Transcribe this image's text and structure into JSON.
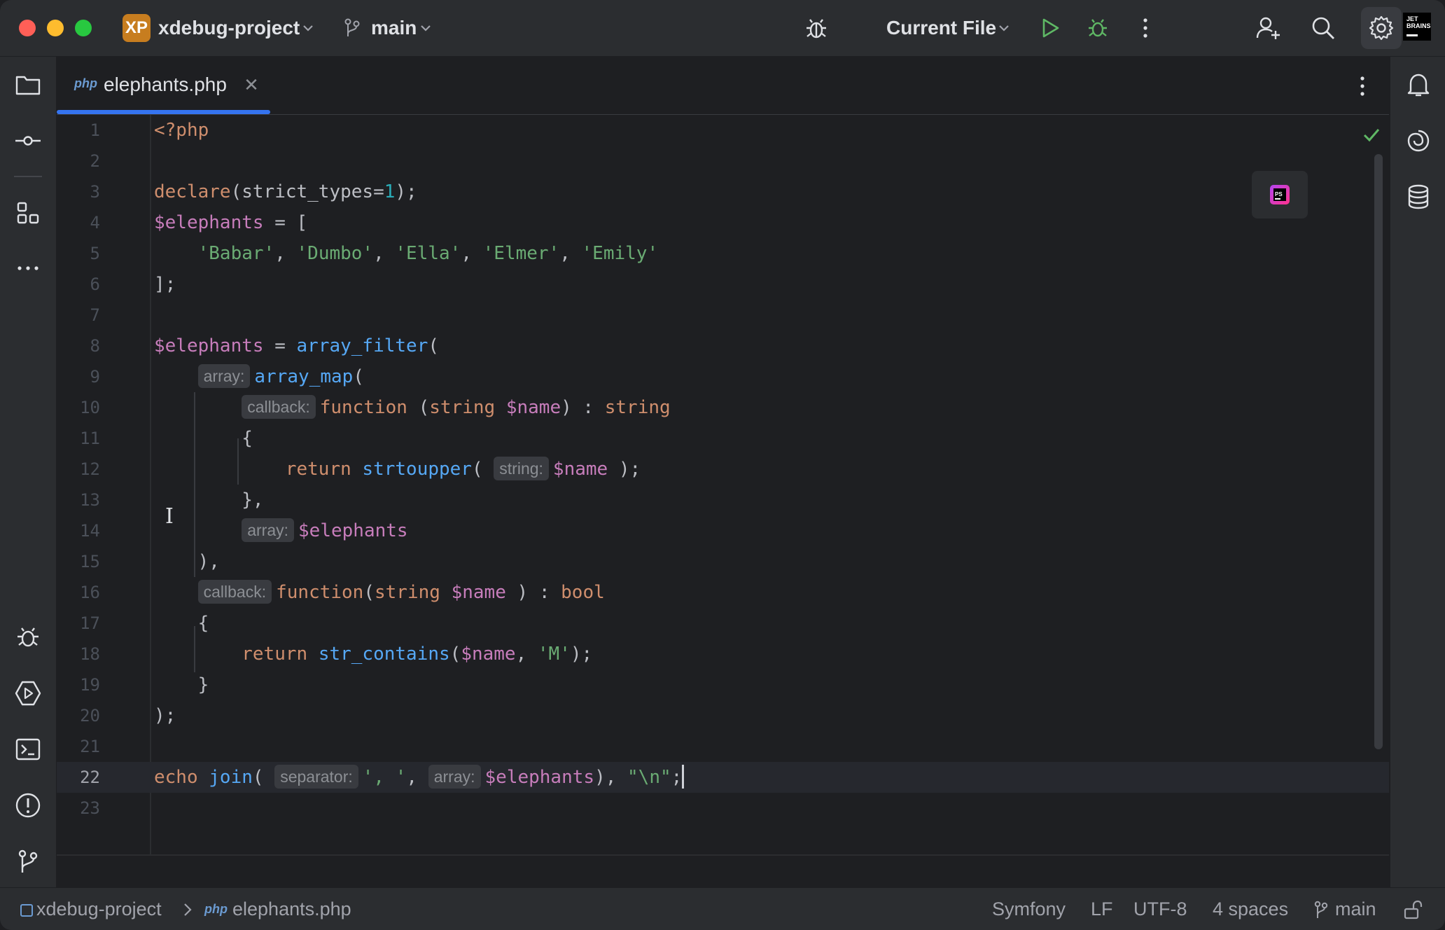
{
  "window": {
    "project_badge": "XP",
    "project_name": "xdebug-project",
    "branch": "main",
    "run_config": "Current File"
  },
  "tabs": [
    {
      "badge": "php",
      "label": "elephants.php",
      "active": true
    }
  ],
  "editor": {
    "current_line": 22,
    "line_numbers": [
      "1",
      "2",
      "3",
      "4",
      "5",
      "6",
      "7",
      "8",
      "9",
      "10",
      "11",
      "12",
      "13",
      "14",
      "15",
      "16",
      "17",
      "18",
      "19",
      "20",
      "21",
      "22",
      "23"
    ],
    "hints": {
      "l9": "array:",
      "l10": "callback:",
      "l12": "string:",
      "l14": "array:",
      "l16": "callback:",
      "l22a": "separator:",
      "l22b": "array:"
    },
    "code": {
      "l1": "<?php",
      "l3_kw": "declare",
      "l3_a": "(strict_types=",
      "l3_num": "1",
      "l3_b": ");",
      "l4_var": "$elephants",
      "l4_rest": " = [",
      "l5_s1": "'Babar'",
      "l5_s2": "'Dumbo'",
      "l5_s3": "'Ella'",
      "l5_s4": "'Elmer'",
      "l5_s5": "'Emily'",
      "sep": ", ",
      "l6": "];",
      "l8_var": "$elephants",
      "l8_eq": " = ",
      "l8_fn": "array_filter",
      "paren_open": "(",
      "l9_fn": "array_map",
      "l10_kw": "function",
      "l10_a": " (",
      "l10_type": "string",
      "l10_var": "$name",
      "l10_b": ") : ",
      "l10_ret": "string",
      "brace_open": "{",
      "l12_kw": "return",
      "l12_fn": "strtoupper",
      "l12_open": "( ",
      "l12_var": "$name",
      "l12_close": " );",
      "l13": "},",
      "l14_var": "$elephants",
      "l15": "),",
      "l16_kw": "function",
      "l16_type": "string",
      "l16_var": "$name",
      "l16_b": " ) : ",
      "l16_ret": "bool",
      "l18_kw": "return",
      "l18_fn": "str_contains",
      "l18_var": "$name",
      "l18_str": "'M'",
      "l18_end": ");",
      "brace_close": "}",
      "l20": ");",
      "l22_kw": "echo",
      "l22_fn": "join",
      "l22_str1": "', '",
      "l22_var": "$elephants",
      "l22_b": "), ",
      "l22_str2": "\"\\n\"",
      "l22_end": ";"
    }
  },
  "status_bar": {
    "project": "xdebug-project",
    "file_badge": "php",
    "file": "elephants.php",
    "framework": "Symfony",
    "line_ending": "LF",
    "encoding": "UTF-8",
    "indent": "4 spaces",
    "branch": "main"
  },
  "colors": {
    "accent": "#3574f0",
    "keyword": "#cf8e6d",
    "variable": "#c77dbb",
    "string": "#6aab73",
    "function": "#56a8f5",
    "number": "#2aacb8"
  }
}
